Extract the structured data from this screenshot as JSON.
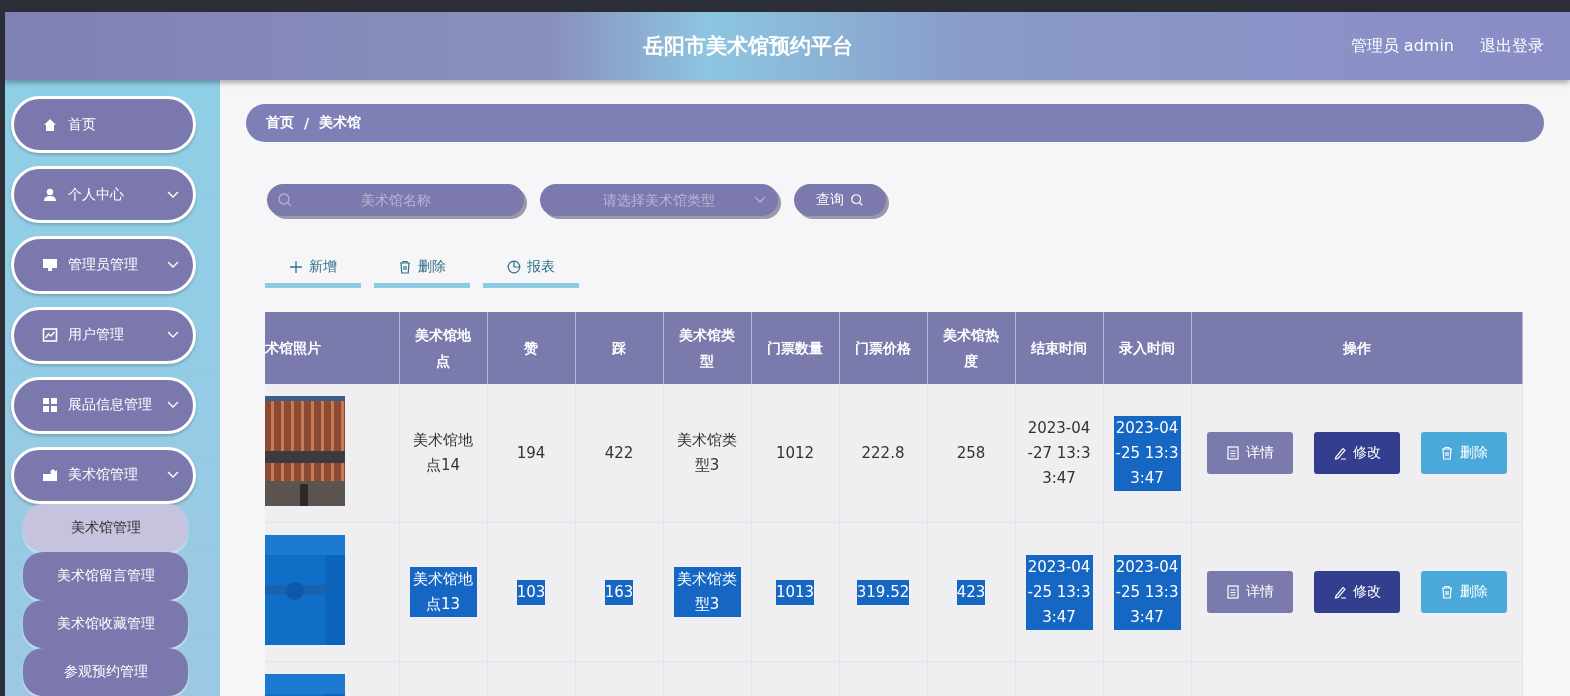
{
  "header": {
    "title": "岳阳市美术馆预约平台",
    "user": "管理员 admin",
    "logout": "退出登录"
  },
  "sidebar": {
    "items": [
      {
        "label": "首页",
        "expandable": false
      },
      {
        "label": "个人中心",
        "expandable": true
      },
      {
        "label": "管理员管理",
        "expandable": true
      },
      {
        "label": "用户管理",
        "expandable": true
      },
      {
        "label": "展品信息管理",
        "expandable": true
      },
      {
        "label": "美术馆管理",
        "expandable": true,
        "children": [
          {
            "label": "美术馆管理",
            "selected": true
          },
          {
            "label": "美术馆留言管理",
            "selected": false
          },
          {
            "label": "美术馆收藏管理",
            "selected": false
          },
          {
            "label": "参观预约管理",
            "selected": false
          }
        ]
      }
    ]
  },
  "breadcrumb": [
    "首页",
    "/",
    "美术馆"
  ],
  "search": {
    "name_placeholder": "美术馆名称",
    "type_placeholder": "请选择美术馆类型",
    "button": "查询"
  },
  "toolbar": [
    {
      "label": "新增",
      "kind": "add"
    },
    {
      "label": "删除",
      "kind": "delete"
    },
    {
      "label": "报表",
      "kind": "report"
    }
  ],
  "table": {
    "columns": [
      "术馆照片",
      "美术馆地点",
      "赞",
      "踩",
      "美术馆类型",
      "门票数量",
      "门票价格",
      "美术馆热度",
      "结束时间",
      "录入时间",
      "操作"
    ],
    "rows": [
      {
        "photo": {
          "kind": "picture"
        },
        "cells": [
          {
            "text": "美术馆地点14",
            "selected": false
          },
          {
            "text": "194",
            "selected": false
          },
          {
            "text": "422",
            "selected": false
          },
          {
            "text": "美术馆类型3",
            "selected": false
          },
          {
            "text": "1012",
            "selected": false
          },
          {
            "text": "222.8",
            "selected": false
          },
          {
            "text": "258",
            "selected": false
          },
          {
            "text": "2023-04-27 13:33:47",
            "selected": false
          },
          {
            "text": "2023-04-25 13:33:47",
            "selected": true
          }
        ],
        "actions": [
          {
            "label": "详情",
            "kind": "detail"
          },
          {
            "label": "修改",
            "kind": "edit"
          },
          {
            "label": "删除",
            "kind": "delete"
          }
        ]
      },
      {
        "photo": {
          "kind": "picture"
        },
        "cells": [
          {
            "text": "美术馆地点13",
            "selected": true
          },
          {
            "text": "103",
            "selected": true
          },
          {
            "text": "163",
            "selected": true
          },
          {
            "text": "美术馆类型3",
            "selected": true
          },
          {
            "text": "1013",
            "selected": true
          },
          {
            "text": "319.52",
            "selected": true
          },
          {
            "text": "423",
            "selected": true
          },
          {
            "text": "2023-04-25 13:33:47",
            "selected": true
          },
          {
            "text": "2023-04-25 13:33:47",
            "selected": true
          }
        ],
        "actions": [
          {
            "label": "详情",
            "kind": "detail"
          },
          {
            "label": "修改",
            "kind": "edit"
          },
          {
            "label": "删除",
            "kind": "delete"
          }
        ]
      },
      {
        "photo": {
          "kind": "picture"
        }
      }
    ]
  }
}
